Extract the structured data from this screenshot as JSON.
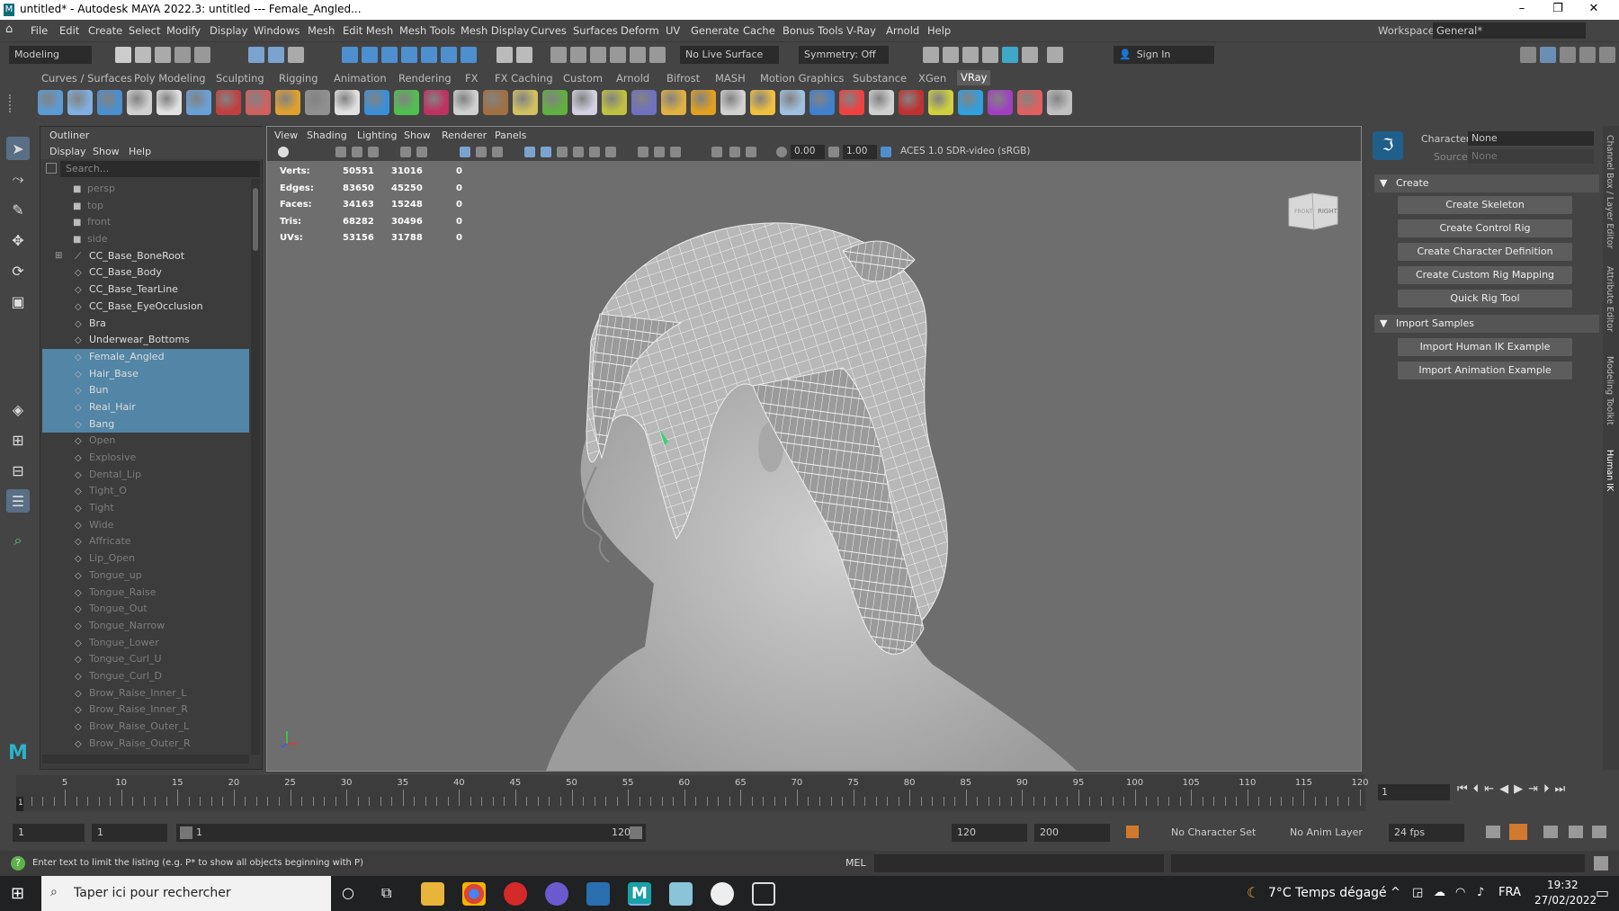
{
  "window": {
    "title": "untitled* - Autodesk MAYA 2022.3: untitled   ---   Female_Angled...",
    "app_icon": "M"
  },
  "menubar": {
    "items": [
      "File",
      "Edit",
      "Create",
      "Select",
      "Modify",
      "Display",
      "Windows",
      "Mesh",
      "Edit Mesh",
      "Mesh Tools",
      "Mesh Display",
      "Curves",
      "Surfaces",
      "Deform",
      "UV",
      "Generate",
      "Cache",
      "Bonus Tools",
      "V-Ray",
      "Arnold",
      "Help"
    ],
    "workspace_label": "Workspace:",
    "workspace_value": "General*"
  },
  "statusline": {
    "mode": "Modeling",
    "live_surface": "No Live Surface",
    "symmetry": "Symmetry: Off",
    "sign_in": "Sign In"
  },
  "shelf": {
    "tabs": [
      "Curves / Surfaces",
      "Poly Modeling",
      "Sculpting",
      "Rigging",
      "Animation",
      "Rendering",
      "FX",
      "FX Caching",
      "Custom",
      "Arnold",
      "Bifrost",
      "MASH",
      "Motion Graphics",
      "Substance",
      "XGen",
      "VRay"
    ],
    "active_tab": "VRay",
    "icon_colors": [
      "#5b9bd5",
      "#7fb0e0",
      "#4a8fd0",
      "#d0d0d0",
      "#e0e0e0",
      "#6aa0d8",
      "#c04040",
      "#d06060",
      "#e0a030",
      "#909090",
      "#e0e0e0",
      "#3a8fd8",
      "#50c050",
      "#c03060",
      "#d0d0d0",
      "#a07040",
      "#d0c060",
      "#60b040",
      "#d0d0e0",
      "#c0c040",
      "#7070c0",
      "#e0b040",
      "#e0a020",
      "#d0d0d0",
      "#f0c040",
      "#a0c0e0",
      "#4080d0",
      "#f04040",
      "#d0d0d0",
      "#c03030",
      "#d0d040",
      "#30a0e0",
      "#a040c0",
      "#e06060",
      "#c0c0c0"
    ]
  },
  "outliner": {
    "title": "Outliner",
    "menu": [
      "Display",
      "Show",
      "Help"
    ],
    "search_placeholder": "Search...",
    "items": [
      {
        "label": "persp",
        "type": "camera",
        "state": "dim"
      },
      {
        "label": "top",
        "type": "camera",
        "state": "dim"
      },
      {
        "label": "front",
        "type": "camera",
        "state": "dim"
      },
      {
        "label": "side",
        "type": "camera",
        "state": "dim"
      },
      {
        "label": "CC_Base_BoneRoot",
        "type": "joint",
        "state": "normal"
      },
      {
        "label": "CC_Base_Body",
        "type": "mesh",
        "state": "normal"
      },
      {
        "label": "CC_Base_TearLine",
        "type": "mesh",
        "state": "normal"
      },
      {
        "label": "CC_Base_EyeOcclusion",
        "type": "mesh",
        "state": "normal"
      },
      {
        "label": "Bra",
        "type": "mesh",
        "state": "normal"
      },
      {
        "label": "Underwear_Bottoms",
        "type": "mesh",
        "state": "normal"
      },
      {
        "label": "Female_Angled",
        "type": "mesh",
        "state": "selected"
      },
      {
        "label": "Hair_Base",
        "type": "mesh",
        "state": "selected"
      },
      {
        "label": "Bun",
        "type": "mesh",
        "state": "selected"
      },
      {
        "label": "Real_Hair",
        "type": "mesh",
        "state": "selected"
      },
      {
        "label": "Bang",
        "type": "mesh",
        "state": "selected"
      },
      {
        "label": "Open",
        "type": "mesh",
        "state": "dim"
      },
      {
        "label": "Explosive",
        "type": "mesh",
        "state": "dim"
      },
      {
        "label": "Dental_Lip",
        "type": "mesh",
        "state": "dim"
      },
      {
        "label": "Tight_O",
        "type": "mesh",
        "state": "dim"
      },
      {
        "label": "Tight",
        "type": "mesh",
        "state": "dim"
      },
      {
        "label": "Wide",
        "type": "mesh",
        "state": "dim"
      },
      {
        "label": "Affricate",
        "type": "mesh",
        "state": "dim"
      },
      {
        "label": "Lip_Open",
        "type": "mesh",
        "state": "dim"
      },
      {
        "label": "Tongue_up",
        "type": "mesh",
        "state": "dim"
      },
      {
        "label": "Tongue_Raise",
        "type": "mesh",
        "state": "dim"
      },
      {
        "label": "Tongue_Out",
        "type": "mesh",
        "state": "dim"
      },
      {
        "label": "Tongue_Narrow",
        "type": "mesh",
        "state": "dim"
      },
      {
        "label": "Tongue_Lower",
        "type": "mesh",
        "state": "dim"
      },
      {
        "label": "Tongue_Curl_U",
        "type": "mesh",
        "state": "dim"
      },
      {
        "label": "Tongue_Curl_D",
        "type": "mesh",
        "state": "dim"
      },
      {
        "label": "Brow_Raise_Inner_L",
        "type": "mesh",
        "state": "dim"
      },
      {
        "label": "Brow_Raise_Inner_R",
        "type": "mesh",
        "state": "dim"
      },
      {
        "label": "Brow_Raise_Outer_L",
        "type": "mesh",
        "state": "dim"
      },
      {
        "label": "Brow_Raise_Outer_R",
        "type": "mesh",
        "state": "dim"
      }
    ]
  },
  "viewport": {
    "menu": [
      "View",
      "Shading",
      "Lighting",
      "Show",
      "Renderer",
      "Panels"
    ],
    "exposure": "0.00",
    "gamma": "1.00",
    "color_space": "ACES 1.0 SDR-video (sRGB)",
    "hud": {
      "rows": [
        {
          "label": "Verts:",
          "total": "50551",
          "selected": "31016",
          "components": "0"
        },
        {
          "label": "Edges:",
          "total": "83650",
          "selected": "45250",
          "components": "0"
        },
        {
          "label": "Faces:",
          "total": "34163",
          "selected": "15248",
          "components": "0"
        },
        {
          "label": "Tris:",
          "total": "68282",
          "selected": "30496",
          "components": "0"
        },
        {
          "label": "UVs:",
          "total": "53156",
          "selected": "31788",
          "components": "0"
        }
      ]
    },
    "viewcube": {
      "face_left": "FRONT",
      "face_right": "RIGHT"
    }
  },
  "hik": {
    "character_label": "Character:",
    "character_value": "None",
    "source_label": "Source:",
    "source_value": "None",
    "create_section": "Create",
    "create_buttons": [
      "Create Skeleton",
      "Create Control Rig",
      "Create Character Definition",
      "Create Custom Rig Mapping",
      "Quick Rig Tool"
    ],
    "import_section": "Import Samples",
    "import_buttons": [
      "Import Human IK Example",
      "Import Animation Example"
    ]
  },
  "side_tabs": [
    "Channel Box / Layer Editor",
    "Attribute Editor",
    "Modeling Toolkit",
    "Human IK"
  ],
  "timeline": {
    "labels": [
      "5",
      "10",
      "15",
      "20",
      "25",
      "30",
      "35",
      "40",
      "45",
      "50",
      "55",
      "60",
      "65",
      "70",
      "75",
      "80",
      "85",
      "90",
      "95",
      "100",
      "105",
      "110",
      "115",
      "120"
    ],
    "current_frame": "1",
    "current_frame_field": "1"
  },
  "range": {
    "start": "1",
    "playback_start": "1",
    "slider_start": "1",
    "slider_end": "120",
    "playback_end": "120",
    "end": "200",
    "character_set": "No Character Set",
    "anim_layer": "No Anim Layer",
    "fps": "24 fps"
  },
  "helpline": {
    "hint": "Enter text to limit the listing (e.g. P* to show all objects beginning with P)",
    "mel_label": "MEL"
  },
  "taskbar": {
    "search_placeholder": "Taper ici pour rechercher",
    "weather": "7°C  Temps dégagé",
    "lang": "FRA",
    "time": "19:32",
    "date": "27/02/2022"
  }
}
